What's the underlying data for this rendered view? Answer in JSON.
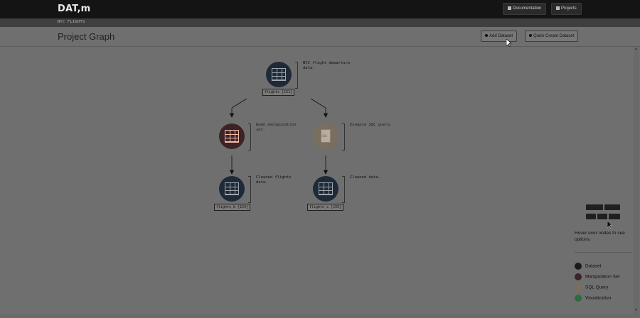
{
  "app": {
    "brand": "DAT,m",
    "nav": {
      "documentation": "Documentation",
      "projects": "Projects"
    },
    "breadcrumb": "NYC FLIGHTS"
  },
  "page": {
    "title": "Project Graph",
    "add_dataset": "Add Dataset",
    "quick_create": "Quick Create Dataset"
  },
  "graph": {
    "nodes": [
      {
        "type": "Dataset",
        "label": "flights [151]",
        "desc": "NYC flight departure data."
      },
      {
        "type": "Manipulation Set",
        "label": "",
        "desc": "Demo manipulation set."
      },
      {
        "type": "SQL Query",
        "label": "",
        "desc": "Example SQL query.",
        "icon_text": "SQL"
      },
      {
        "type": "Dataset",
        "label": "flights_b [154]",
        "desc": "Cleaned flights data."
      },
      {
        "type": "Dataset",
        "label": "flights_c [155]",
        "desc": "Cleaned data."
      }
    ]
  },
  "sidebar": {
    "hint": "Hover over nodes to see options.",
    "legend": [
      {
        "label": "Dataset",
        "color": "#1a1a1a"
      },
      {
        "label": "Manipulation Set",
        "color": "#3d2226"
      },
      {
        "label": "SQL Query",
        "color": "#7a6e5f"
      },
      {
        "label": "Visualization",
        "color": "#2e6b3c"
      }
    ]
  }
}
